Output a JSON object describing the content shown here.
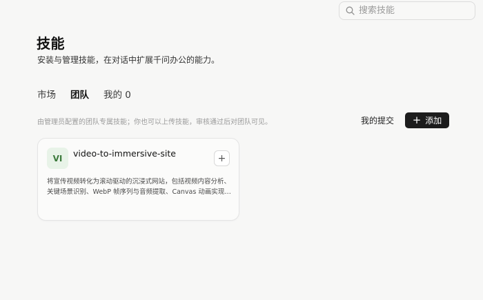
{
  "search": {
    "placeholder": "搜索技能",
    "value": "",
    "icon": "search-icon"
  },
  "header": {
    "title": "技能",
    "subtitle": "安装与管理技能，在对话中扩展千问办公的能力。"
  },
  "tabs": [
    {
      "label": "市场",
      "active": false
    },
    {
      "label": "团队",
      "active": true
    },
    {
      "label": "我的 0",
      "active": false
    }
  ],
  "team": {
    "info": "由管理员配置的团队专属技能；你也可以上传技能，审核通过后对团队可见。",
    "submissions_label": "我的提交",
    "add_label": "添加",
    "add_icon": "plus-icon"
  },
  "skills": [
    {
      "initials": "VI",
      "name": "video-to-immersive-site",
      "description": "将宣传视频转化为滚动驱动的沉浸式网站，包括视频内容分析、关键场景识别、WebP 帧序列与音频提取、Canvas 动画实现与部署。",
      "action_icon": "plus-icon"
    }
  ],
  "colors": {
    "background": "#f7f7f6",
    "primary_button": "#1c1c1c",
    "avatar_bg": "#e8f3e8",
    "avatar_text": "#3c7a3c"
  }
}
